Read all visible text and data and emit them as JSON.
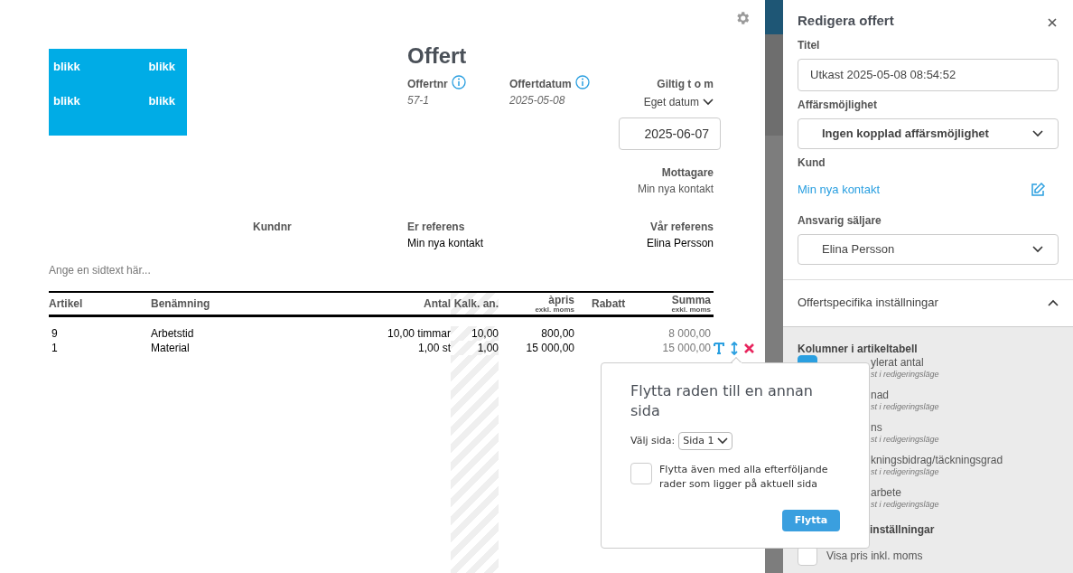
{
  "document": {
    "logo_texts": [
      "blikk",
      "blikk",
      "blikk",
      "blikk"
    ],
    "title": "Offert",
    "meta": [
      {
        "label": "Offertnr",
        "value": "57-1"
      },
      {
        "label": "Offertdatum",
        "value": "2025-05-08"
      }
    ],
    "valid": {
      "label": "Giltig t o m",
      "mode": "Eget datum",
      "date": "2025-06-07"
    },
    "recipient": {
      "label": "Mottagare",
      "value": "Min nya kontakt"
    },
    "references": [
      {
        "label": "Kundnr"
      },
      {
        "label": "Er referens",
        "value": "Min nya kontakt"
      },
      {
        "label": "Vår referens",
        "value": "Elina Persson"
      }
    ],
    "page_text_placeholder": "Ange en sidtext här...",
    "table": {
      "columns": [
        {
          "label": "Artikel"
        },
        {
          "label": "Benämning"
        },
        {
          "label": "Antal"
        },
        {
          "label": "Kalk. an."
        },
        {
          "label": "àpris",
          "sub": "exkl. moms"
        },
        {
          "label": "Rabatt"
        },
        {
          "label": "Summa",
          "sub": "exkl. moms"
        }
      ],
      "rows": [
        {
          "cells": [
            "9",
            "Arbetstid",
            "10,00 timmar",
            "10,00",
            "800,00",
            "",
            "8 000,00"
          ],
          "actions": false
        },
        {
          "cells": [
            "1",
            "Material",
            "1,00 st",
            "1,00",
            "15 000,00",
            "",
            "15 000,00"
          ],
          "actions": true
        }
      ]
    }
  },
  "popover": {
    "title": "Flytta raden till en annan sida",
    "select_label": "Välj sida:",
    "select_value": "Sida 1",
    "checkbox_label": "Flytta även med alla efterföljande rader som ligger på aktuell sida",
    "checked": false,
    "button": "Flytta"
  },
  "sidebar": {
    "title": "Redigera offert",
    "fields": [
      {
        "kind": "input",
        "label": "Titel",
        "value": "Utkast 2025-05-08 08:54:52"
      },
      {
        "kind": "select",
        "label": "Affärsmöjlighet",
        "value": "Ingen kopplad affärsmöjlighet",
        "bold": true
      },
      {
        "kind": "link",
        "label": "Kund",
        "value": "Min nya kontakt"
      },
      {
        "kind": "select",
        "label": "Ansvarig säljare",
        "value": "Elina Persson",
        "bold": false
      }
    ],
    "section": {
      "title": "Offertspecifika inställningar",
      "expanded": true,
      "group_title": "Kolumner i artikeltabell",
      "columns": [
        {
          "label": "ylerat antal",
          "note": "st i redigeringsläge",
          "checked": true
        },
        {
          "label": "nad",
          "note": "st i redigeringsläge"
        },
        {
          "label": "ns",
          "note": "st i redigeringsläge"
        },
        {
          "label": "kningsbidrag/täckningsgrad",
          "note": "st i redigeringsläge"
        },
        {
          "label": "arbete",
          "note": "st i redigeringsläge"
        }
      ],
      "group2_title": "inställningar",
      "options": [
        {
          "label": "Visa pris inkl. moms",
          "checked": false
        }
      ]
    }
  }
}
